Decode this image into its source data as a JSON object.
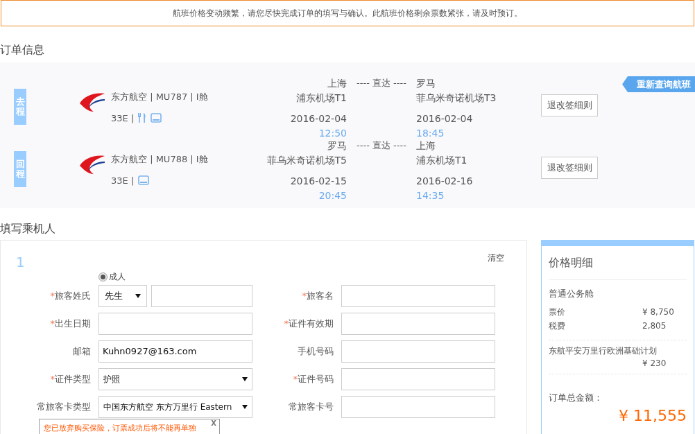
{
  "notice": "航班价格变动频繁，请您尽快完成订单的填写与确认。此航班价格剩余票数紧张，请及时预订。",
  "order_title": "订单信息",
  "requery_button": "重新查询航班",
  "flights": [
    {
      "direction": "去程",
      "airline": "东方航空 | MU787 | I舱",
      "seat": "33E |",
      "amenities": [
        {
          "kind": "meal"
        },
        {
          "kind": "screen"
        }
      ],
      "route": "---- 直达 ----",
      "depart": {
        "city": "上海",
        "airport": "浦东机场T1",
        "date": "2016-02-04",
        "time": "12:50"
      },
      "arrive": {
        "city": "罗马",
        "airport": "菲乌米奇诺机场T3",
        "date": "2016-02-04",
        "time": "18:45"
      },
      "rules_button": "退改签细则"
    },
    {
      "direction": "回程",
      "airline": "东方航空 | MU788 | I舱",
      "seat": "33E |",
      "amenities": [
        {
          "kind": "screen"
        }
      ],
      "route": "---- 直达 ----",
      "depart": {
        "city": "罗马",
        "airport": "菲乌米奇诺机场T5",
        "date": "2016-02-15",
        "time": "20:45"
      },
      "arrive": {
        "city": "上海",
        "airport": "浦东机场T1",
        "date": "2016-02-16",
        "time": "14:35"
      },
      "rules_button": "退改签细则"
    }
  ],
  "passenger_title": "填写乘机人",
  "passenger": {
    "index": "1",
    "clear": "清空",
    "types": [
      {
        "label": "成人",
        "selected": true
      }
    ],
    "rows": [
      {
        "left": {
          "mark": "*",
          "label": "旅客姓氏",
          "kind": "title_name",
          "select": "先生"
        },
        "right": {
          "mark": "*",
          "label": "旅客名",
          "kind": "input"
        }
      },
      {
        "left": {
          "mark": "*",
          "label": "出生日期",
          "kind": "input"
        },
        "right": {
          "mark": "*",
          "label": "证件有效期",
          "kind": "input"
        }
      },
      {
        "left": {
          "label": "邮箱",
          "kind": "input",
          "value": "Kuhn0927@163.com"
        },
        "right": {
          "label": "手机号码",
          "kind": "input"
        }
      },
      {
        "left": {
          "mark": "*",
          "label": "证件类型",
          "kind": "select",
          "value": "护照"
        },
        "right": {
          "mark": "*",
          "label": "证件号码",
          "kind": "input"
        }
      },
      {
        "left": {
          "label": "常旅客卡类型",
          "kind": "select",
          "value": "中国东方航空 东方万里行 Eastern"
        },
        "right": {
          "label": "常旅客卡号",
          "kind": "input"
        }
      }
    ]
  },
  "price": {
    "title": "价格明细",
    "cabin": "普通公务舱",
    "items": [
      {
        "label": "票价",
        "value": "¥ 8,750"
      },
      {
        "label": "税费",
        "value": "2,805"
      }
    ],
    "insurance": {
      "label": "东航平安万里行欧洲基础计划",
      "value": "¥ 230"
    },
    "total_label": "订单总金额：",
    "total": "¥ 11,555"
  },
  "popup": {
    "close": "X",
    "message": "您已放弃购买保险，订票成功后将不能再单独"
  }
}
